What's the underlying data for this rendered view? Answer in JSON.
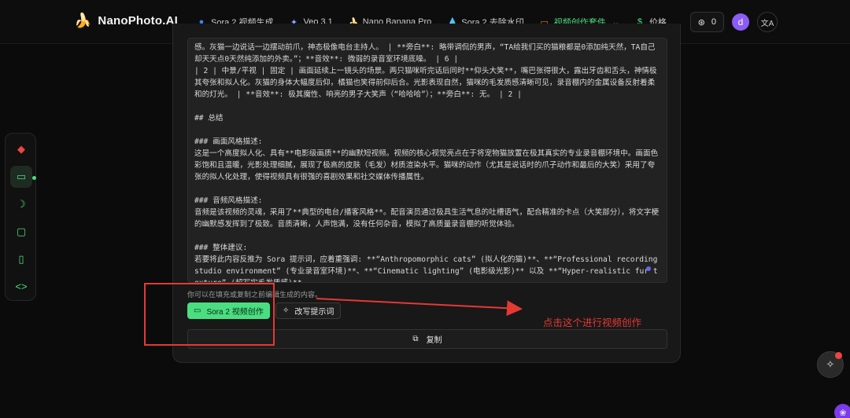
{
  "brand": {
    "logo": "🍌",
    "name": "NanoPhoto.AI"
  },
  "nav": [
    {
      "label": "Sora 2 视频生成",
      "icon": "●",
      "icon_name": "openai-icon",
      "cls": "ico-blue"
    },
    {
      "label": "Veo 3.1",
      "icon": "✦",
      "icon_name": "sparkle-icon",
      "cls": "ico-sparkle"
    },
    {
      "label": "Nano Banana Pro",
      "icon": "🍌",
      "icon_name": "banana-icon",
      "cls": "ico-banana"
    },
    {
      "label": "Sora 2 去除水印",
      "icon": "💧",
      "icon_name": "droplet-icon",
      "cls": "ico-drop"
    },
    {
      "label": "视频创作套件",
      "icon": "▭",
      "icon_name": "video-camera-icon",
      "cls": "ico-cam",
      "active": true,
      "dropdown": "⌄"
    },
    {
      "label": "价格",
      "icon": "$",
      "icon_name": "dollar-icon",
      "cls": "ico-dollar"
    }
  ],
  "account": {
    "credits": "0",
    "credits_icon": "⊛",
    "avatar_letter": "d",
    "lang_icon": "文A"
  },
  "rail_icons": [
    {
      "name": "gem-icon",
      "glyph": "◆",
      "color": "#ef4444"
    },
    {
      "name": "video-camera-icon",
      "glyph": "▭",
      "active": true
    },
    {
      "name": "banana-icon",
      "glyph": "☽"
    },
    {
      "name": "monitor-icon",
      "glyph": "▢"
    },
    {
      "name": "book-icon",
      "glyph": "▯"
    },
    {
      "name": "code-icon",
      "glyph": "<>"
    }
  ],
  "content_lines": [
    "感。灰猫一边说话一边摆动前爪，神态极像电台主持人。 | **旁白**: 略带调侃的男声，“TA给我们买的猫粮都是0添加纯天然，TA自己却天天点0天然纯添加的外卖。”；**音效**: 微弱的录音室环境底噪。 | 6 |",
    "| 2 | 中景/平视 | 固定 | 画面延续上一镜头的场景。两只猫咪听完话后同时**仰头大笑**，嘴巴张得很大，露出牙齿和舌头，神情极其夸张和拟人化。灰猫的身体大幅度后仰，橘猫也笑得前仰后合。光影表现自然，猫咪的毛发质感清晰可见，录音棚内的金属设备反射着柔和的灯光。 | **音效**: 极其魔性、响亮的男子大笑声（“哈哈哈”）；**旁白**: 无。 | 2 |",
    "",
    "## 总结",
    "",
    "### 画面风格描述:",
    "这是一个高度拟人化、具有**电影级画质**的幽默短视频。视频的核心视觉亮点在于将宠物猫放置在极其真实的专业录音棚环境中。画面色彩饱和且温暖，光影处理细腻，展现了极高的皮肤（毛发）材质渲染水平。猫咪的动作（尤其是说话时的爪子动作和最后的大笑）采用了夸张的拟人化处理，使得视频具有很强的喜剧效果和社交媒体传播属性。",
    "",
    "### 音频风格描述:",
    "音频是该视频的灵魂，采用了**典型的电台/播客风格**。配音演员通过极具生活气息的吐槽语气，配合精准的卡点（大笑部分），将文字梗的幽默感发挥到了极致。音质清晰，人声饱满，没有任何杂音，模拟了高质量录音棚的听觉体验。",
    "",
    "### 整体建议:",
    "若要将此内容反推为 Sora 提示词，应着重强调: **“Anthropomorphic cats” (拟人化的猫)**、**“Professional recording studio environment” (专业录音室环境)**、**“Cinematic lighting” (电影级光影)** 以及 **“Hyper-realistic fur texture” (超写实毛发质感)**。"
  ],
  "hint": "你可以在填充或复制之前编辑生成的内容。",
  "buttons": {
    "sora": "Sora 2 视频创作",
    "rewrite": "改写提示词",
    "copy": "复制"
  },
  "annotation": "点击这个进行视频创作",
  "colors": {
    "accent": "#4ade80",
    "annotation": "#e53935"
  }
}
